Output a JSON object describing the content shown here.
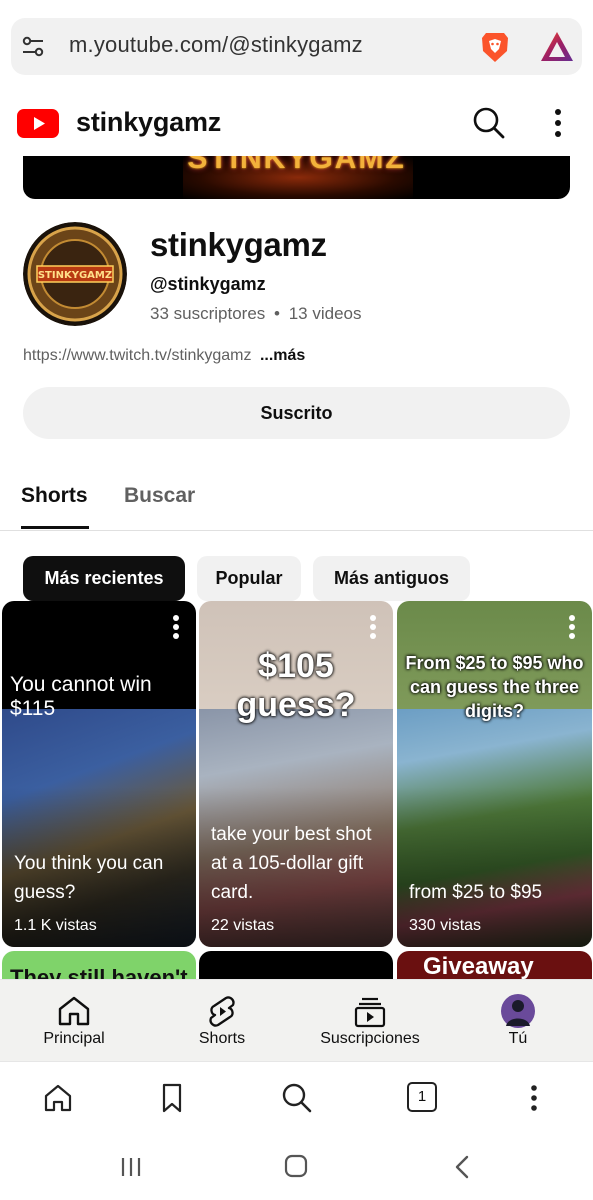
{
  "browser": {
    "url": "m.youtube.com/@stinkygamz",
    "tab_count": "1"
  },
  "header": {
    "title": "stinkygamz"
  },
  "banner": {
    "text": "STINKYGAMZ"
  },
  "channel": {
    "name": "stinkygamz",
    "handle": "@stinkygamz",
    "subscribers": "33 suscriptores",
    "separator": "•",
    "videos": "13 videos",
    "link": "https://www.twitch.tv/stinkygamz",
    "more": "...más",
    "subscribe_label": "Suscrito"
  },
  "tabs": [
    {
      "label": "Shorts"
    },
    {
      "label": "Buscar"
    }
  ],
  "chips": [
    {
      "label": "Más recientes"
    },
    {
      "label": "Popular"
    },
    {
      "label": "Más antiguos"
    }
  ],
  "shorts": [
    {
      "overlay": "You cannot win $115",
      "title": "You think you can guess?",
      "views": "1.1 K vistas"
    },
    {
      "overlay": "$105 guess?",
      "title": "take your best shot at a 105-dollar gift card.",
      "views": "22 vistas"
    },
    {
      "overlay": "From $25 to $95 who can guess the three digits?",
      "title": "from $25 to $95",
      "views": "330 vistas"
    }
  ],
  "peek_row": [
    {
      "overlay": "They still haven't"
    },
    {
      "overlay": ""
    },
    {
      "overlay": "Giveaway"
    }
  ],
  "bottom_nav": [
    {
      "label": "Principal"
    },
    {
      "label": "Shorts"
    },
    {
      "label": "Suscripciones"
    },
    {
      "label": "Tú"
    }
  ],
  "colors": {
    "yt_red": "#ff0000",
    "chip_selected": "#0f0f0f"
  }
}
